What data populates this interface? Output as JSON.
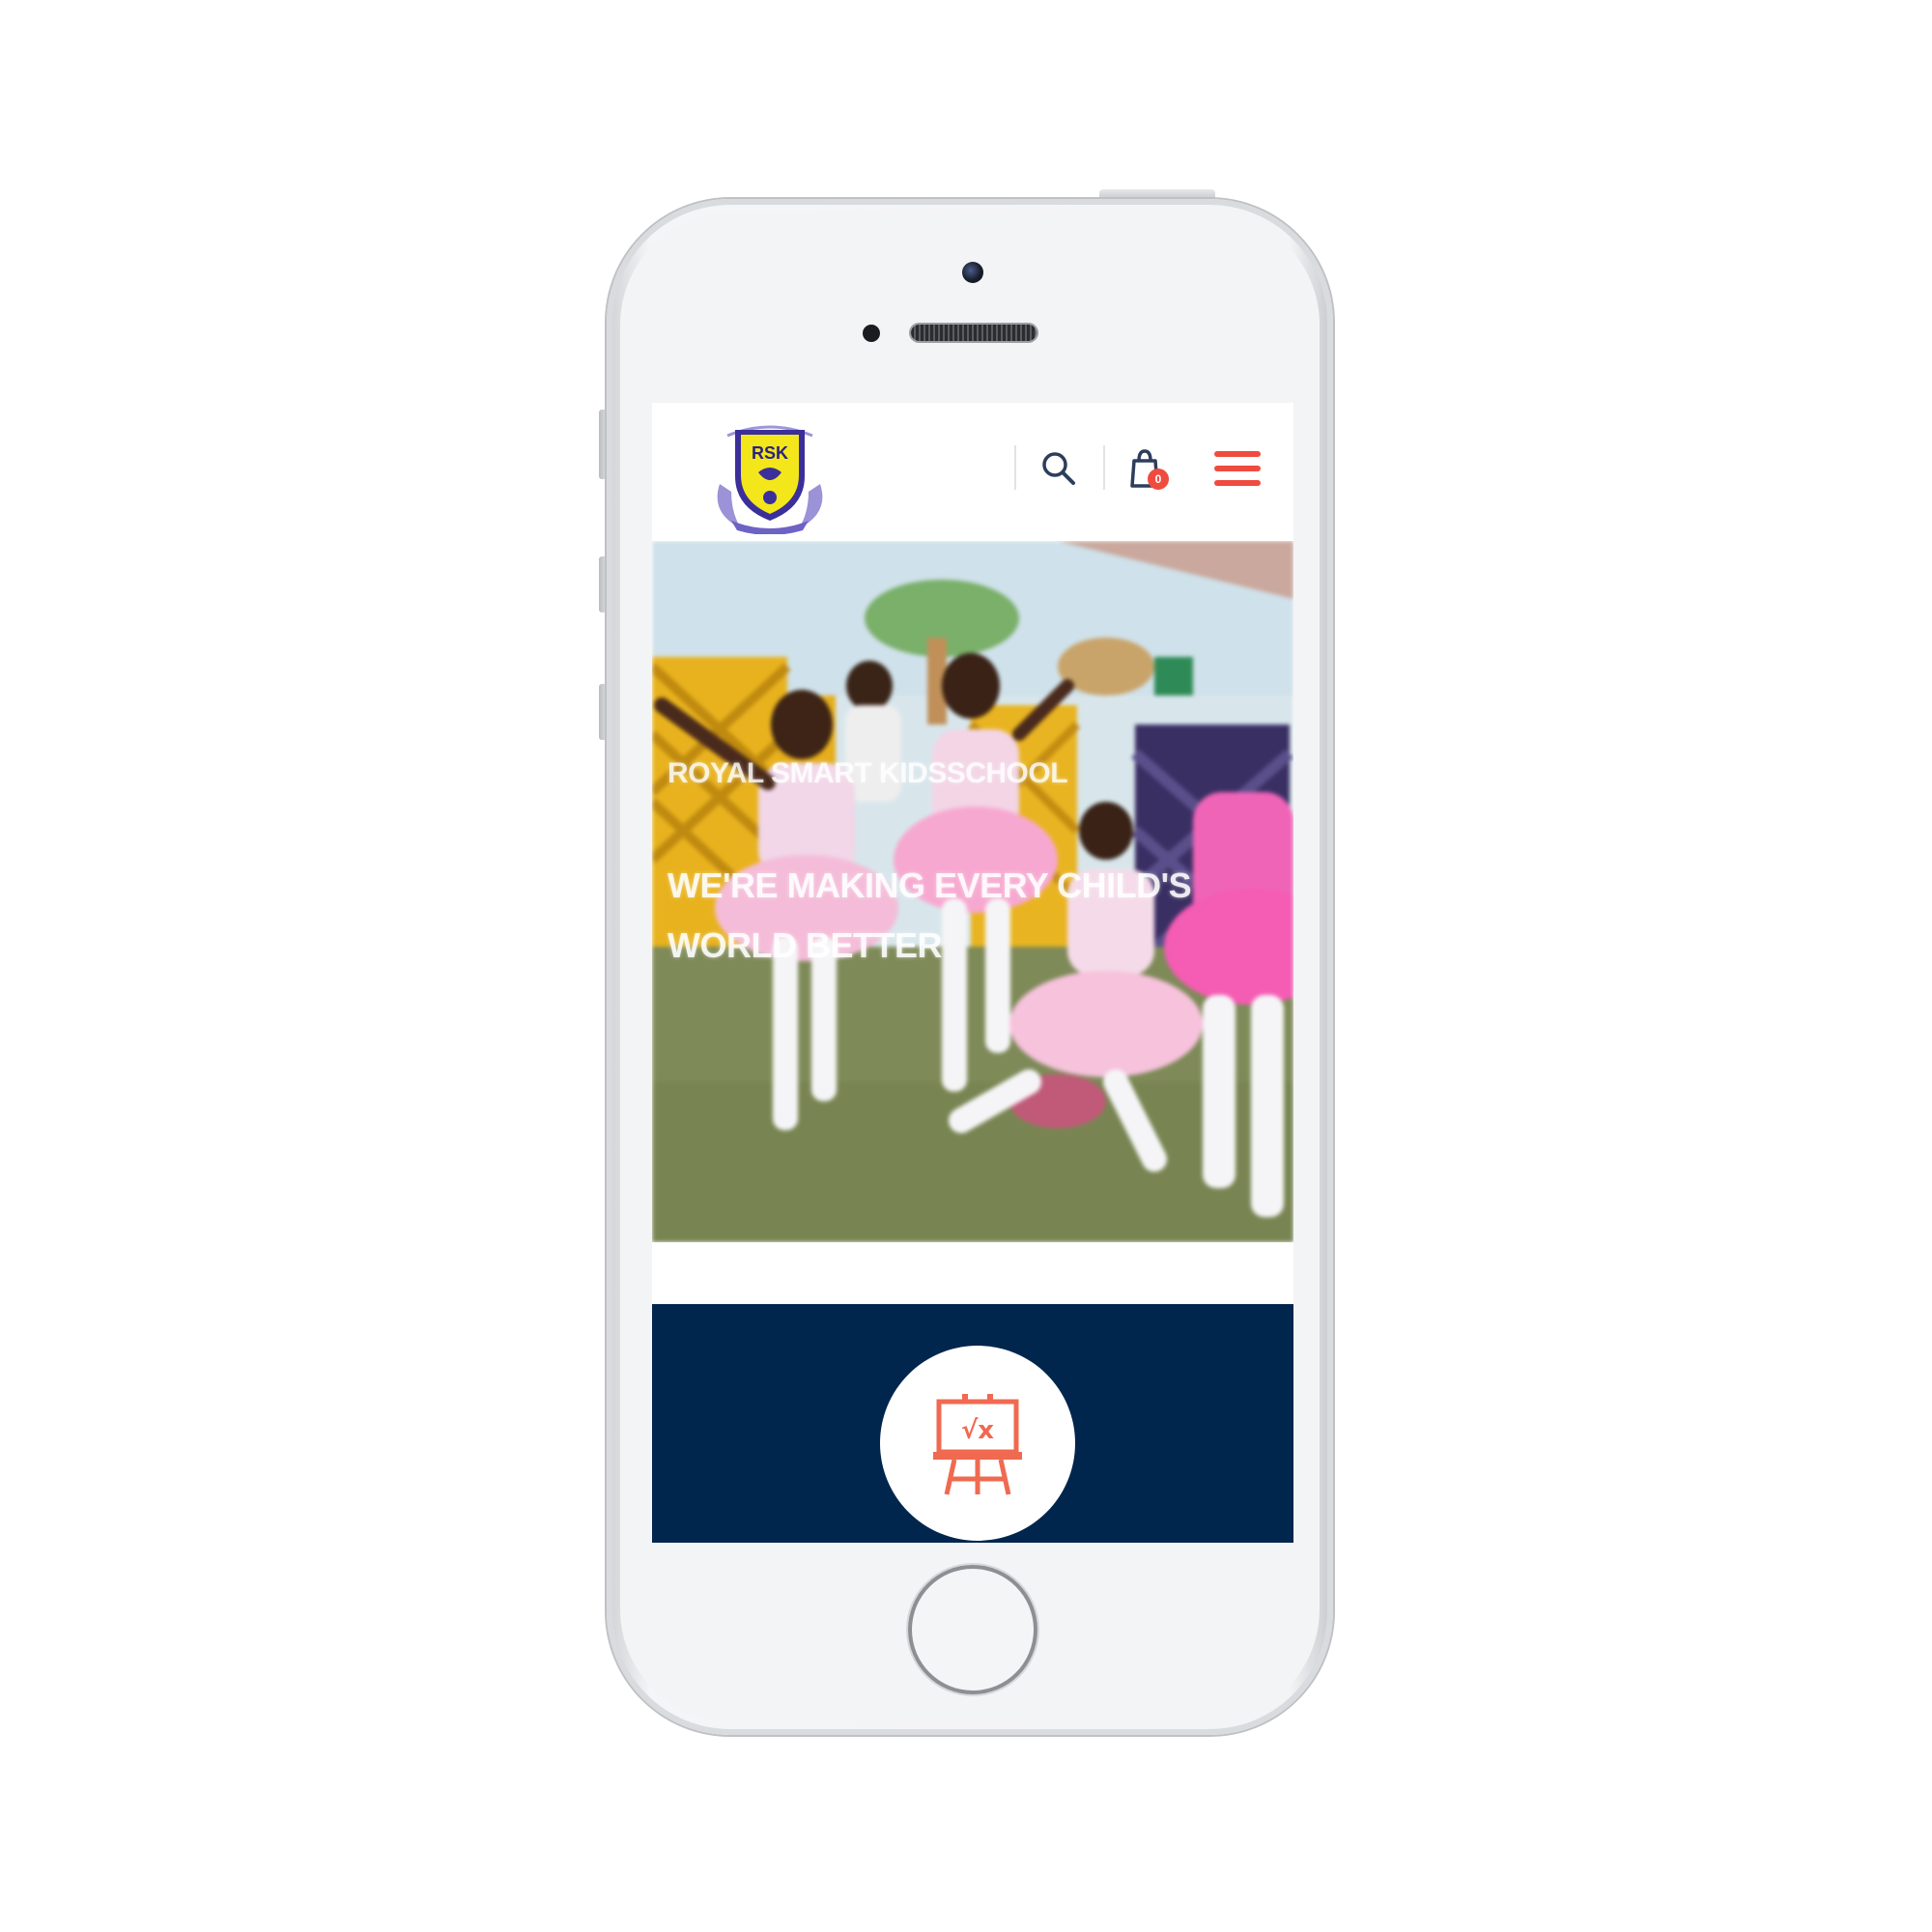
{
  "header": {
    "logo_name": "Royal Smart Kids School crest",
    "logo_text": "RSK",
    "cart_count": "0",
    "icons": [
      "search-icon",
      "cart-icon",
      "hamburger-menu-icon"
    ],
    "accent_color": "#ef4b3f"
  },
  "hero": {
    "kicker": "ROYAL SMART KIDSSCHOOL",
    "title": "WE'RE MAKING EVERY CHILD'S WORLD BETTER"
  },
  "feature": {
    "icon": "math-easel-icon",
    "icon_text": "√x",
    "background_color": "#00264d"
  }
}
